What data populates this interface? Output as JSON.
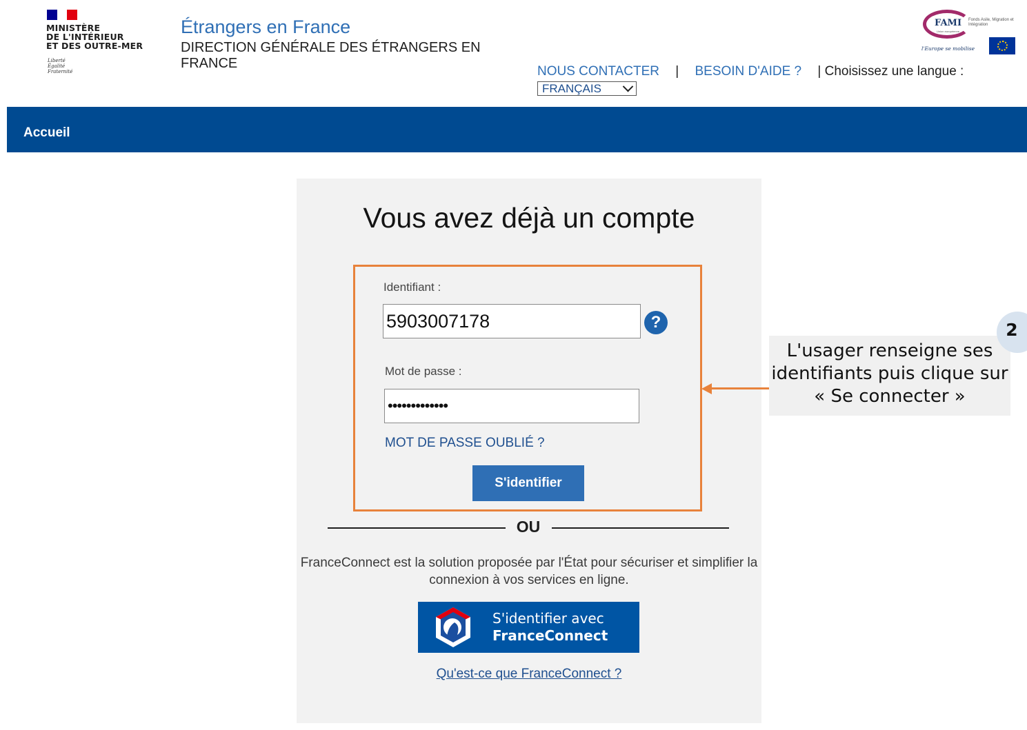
{
  "header": {
    "flag_colors": [
      "#000091",
      "#ffffff",
      "#e1000f"
    ],
    "ministry_lines": [
      "MINISTÈRE",
      "DE L'INTÉRIEUR",
      "ET DES OUTRE-MER"
    ],
    "motto_lines": [
      "Liberté",
      "Égalité",
      "Fraternité"
    ],
    "site_title": "Étrangers en France",
    "site_subtitle": "DIRECTION GÉNÉRALE DES ÉTRANGERS EN FRANCE",
    "contact_link": "NOUS CONTACTER",
    "help_link": "BESOIN D'AIDE ?",
    "separator": "|",
    "language_prompt": "| Choisissez une langue :",
    "language_selected": "FRANÇAIS",
    "fami_logo": {
      "name": "FAMI",
      "small_text": "Fonds Asile, Migration et Intégration",
      "eu_text": "Union européenne",
      "tagline": "l'Europe se mobilise"
    }
  },
  "nav": {
    "home": "Accueil",
    "bar_color": "#004a91"
  },
  "login": {
    "title": "Vous avez déjà un compte",
    "identifier_label": "Identifiant :",
    "identifier_value": "5903007178",
    "help_icon": "?",
    "password_label": "Mot de passe :",
    "password_value": "•••••••••••••",
    "forgot_password": "MOT DE PASSE OUBLIÉ ?",
    "submit": "S'identifier",
    "highlight_color": "#e8823b"
  },
  "alt_login": {
    "or": "OU",
    "description": "FranceConnect est la solution proposée par l'État pour sécuriser et simplifier la connexion à vos services en ligne.",
    "button_line1": "S'identifier avec",
    "button_line2": "FranceConnect",
    "info_link": "Qu'est-ce que FranceConnect ?"
  },
  "annotation": {
    "step": "2",
    "text": "L'usager renseigne ses identifiants puis clique sur « Se connecter »"
  }
}
